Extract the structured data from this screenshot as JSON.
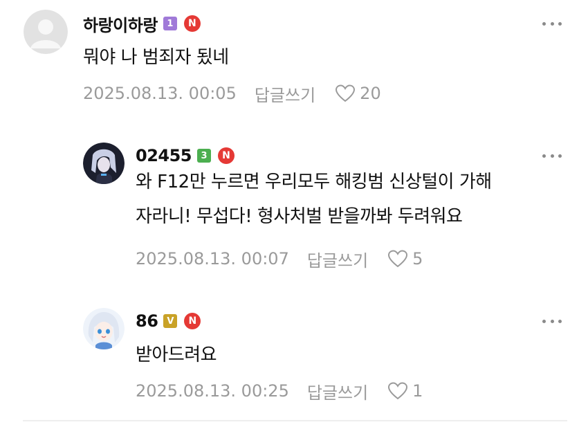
{
  "comments": [
    {
      "username": "하랑이하랑",
      "level": "1",
      "level_color": "#a07ad8",
      "text_lines": [
        "뭐야 나 범죄자 됬네"
      ],
      "date": "2025.08.13. 00:05",
      "reply_label": "답글쓰기",
      "likes": "20",
      "avatar": "default-avatar"
    },
    {
      "username": "02455",
      "level": "3",
      "level_color": "#4caf50",
      "text_lines": [
        "와 F12만 누르면 우리모두 해킹범 신상털이 가해",
        "자라니! 무섭다! 형사처벌 받을까봐 두려워요"
      ],
      "date": "2025.08.13. 00:07",
      "reply_label": "답글쓰기",
      "likes": "5",
      "avatar": "anime-dark-avatar"
    },
    {
      "username": "86",
      "level": "V",
      "level_color": "#c9a227",
      "text_lines": [
        "받아드려요"
      ],
      "date": "2025.08.13. 00:25",
      "reply_label": "답글쓰기",
      "likes": "1",
      "avatar": "anime-white-hair-avatar"
    }
  ],
  "n_badge_label": "N",
  "colors": {
    "n_badge": "#e53935",
    "meta_text": "#9a9a9a"
  }
}
